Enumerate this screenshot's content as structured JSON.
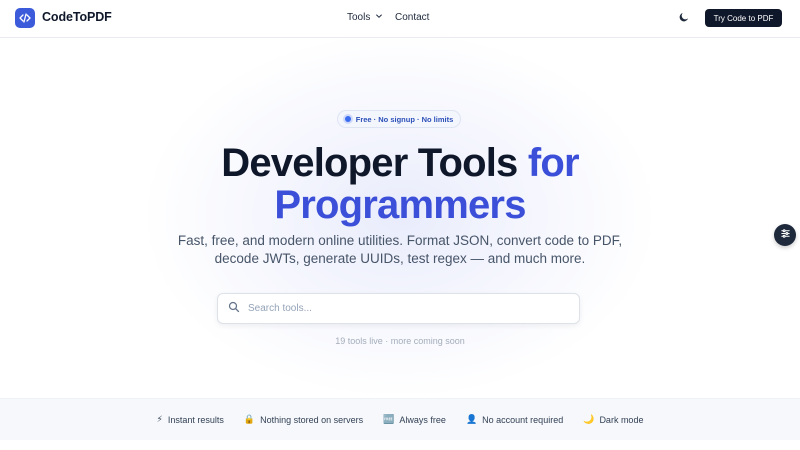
{
  "header": {
    "brand": "CodeToPDF",
    "nav": {
      "tools_label": "Tools",
      "contact_label": "Contact"
    },
    "cta_label": "Try Code to PDF"
  },
  "hero": {
    "pill_text": "Free · No signup · No limits",
    "title_line1": "Developer Tools ",
    "title_accent1": "for",
    "title_line2": "Programmers",
    "subtitle": "Fast, free, and modern online utilities. Format JSON, convert code to PDF, decode JWTs, generate UUIDs, test regex — and much more.",
    "search": {
      "placeholder": "Search tools...",
      "value": ""
    },
    "tools_count": "19 tools live · more coming soon"
  },
  "features": [
    {
      "icon": "⚡",
      "label": "Instant results"
    },
    {
      "icon": "🔒",
      "label": "Nothing stored on servers"
    },
    {
      "icon": "🆓",
      "label": "Always free"
    },
    {
      "icon": "👤",
      "label": "No account required"
    },
    {
      "icon": "🌙",
      "label": "Dark mode"
    }
  ],
  "colors": {
    "brand": "#3b5bdb",
    "accent_text": "#3b4fd8",
    "dark": "#0f172a"
  },
  "icons": {
    "logo": "code-brackets-icon",
    "tools_dropdown": "chevron-down-icon",
    "theme": "moon-icon",
    "search": "search-icon",
    "floating": "sliders-icon"
  }
}
